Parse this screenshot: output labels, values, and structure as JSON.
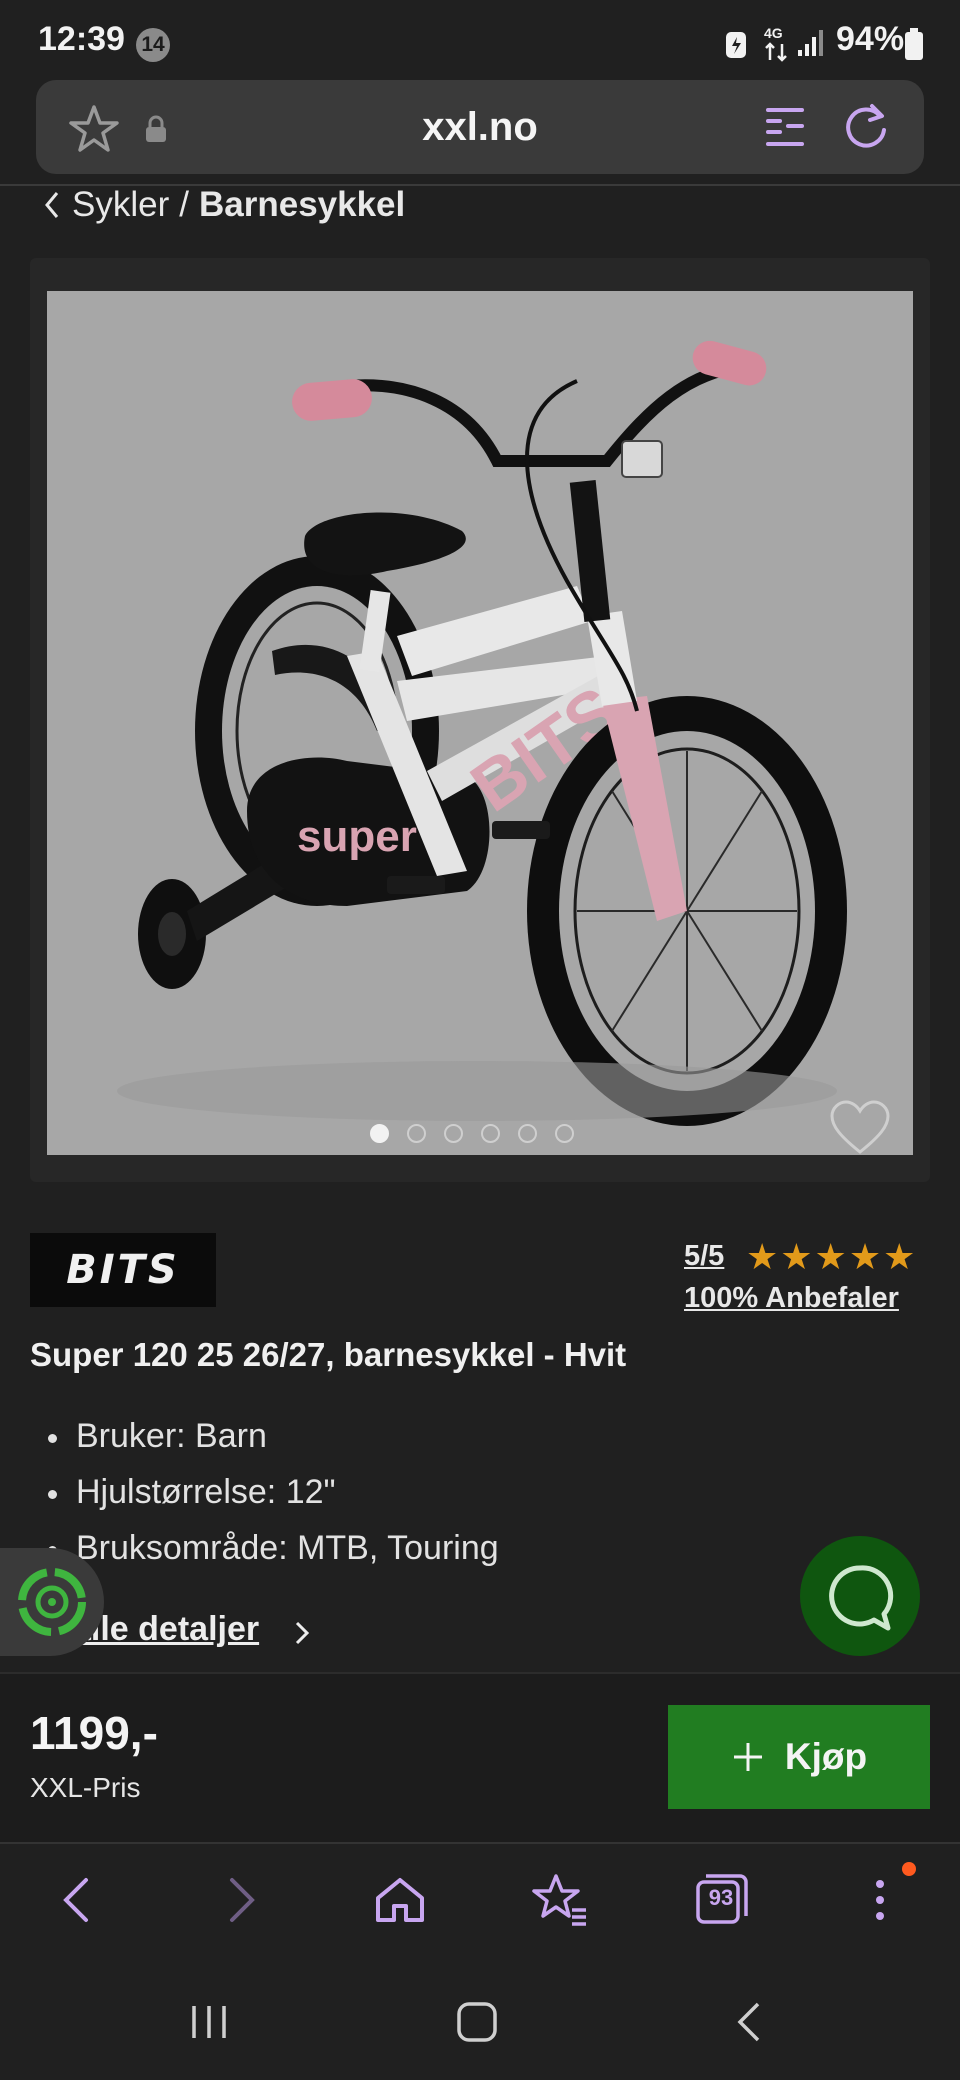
{
  "status_bar": {
    "time": "12:39",
    "notification_count": "14",
    "network": "4G",
    "battery": "94%"
  },
  "browser": {
    "url": "xxl.no",
    "open_tabs": "93"
  },
  "breadcrumb": {
    "parent": "Sykler",
    "separator": "/",
    "current": "Barnesykkel"
  },
  "gallery": {
    "total_images": 6,
    "active_index": 0
  },
  "product": {
    "brand": "BITS",
    "rating": "5/5",
    "stars": "★★★★★",
    "recommend": "100% Anbefaler",
    "title": "Super 120 25 26/27, barnesykkel - Hvit",
    "specs": [
      "Bruker: Barn",
      "Hjulstørrelse: 12\"",
      "Bruksområde: MTB, Touring"
    ],
    "all_details_label": "alle detaljer",
    "price": "1199,-",
    "price_label": "XXL-Pris",
    "buy_label": "Kjøp"
  },
  "colors": {
    "accent_green": "#217d21",
    "star_color": "#e29a1a",
    "icon_purple": "#c8a6f0"
  },
  "icons": [
    "star-icon",
    "lock-icon",
    "reader-mode-icon",
    "reload-icon",
    "heart-icon",
    "chat-icon",
    "back-icon",
    "forward-icon",
    "home-icon",
    "bookmarks-icon",
    "tabs-icon",
    "menu-icon"
  ]
}
